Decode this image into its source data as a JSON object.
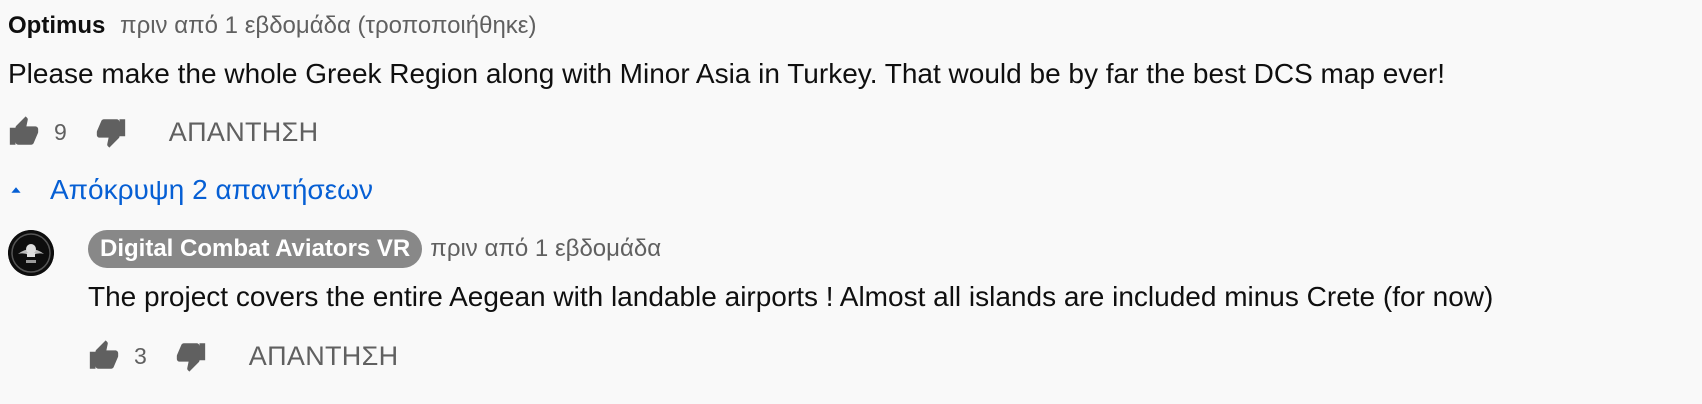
{
  "comment": {
    "author": "Optimus",
    "timestamp": "πριν από 1 εβδομάδα (τροποποιήθηκε)",
    "text": "Please make the whole Greek Region along with Minor Asia in Turkey. That would be by far the best DCS map ever!",
    "like_count": "9",
    "reply_label": "ΑΠΑΝΤΗΣΗ",
    "icons": {
      "like": "thumbs-up-icon",
      "dislike": "thumbs-down-icon"
    }
  },
  "replies_toggle": {
    "label": "Απόκρυψη 2 απαντήσεων",
    "icon": "caret-up-icon",
    "color": "#065fd4"
  },
  "reply": {
    "author": "Digital Combat Aviators VR",
    "timestamp": "πριν από 1 εβδομάδα",
    "text": "The project covers the entire Aegean with landable airports ! Almost all islands are included minus Crete (for now)",
    "like_count": "3",
    "reply_label": "ΑΠΑΝΤΗΣΗ",
    "author_chip_color": "#888888"
  }
}
